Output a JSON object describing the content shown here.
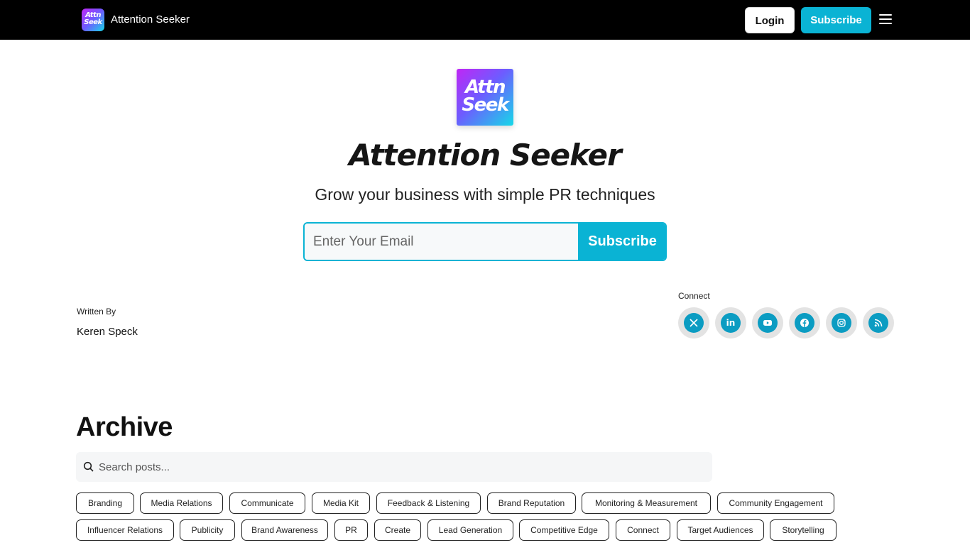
{
  "nav": {
    "logo_line1": "Attn",
    "logo_line2": "Seek",
    "title": "Attention Seeker",
    "login_label": "Login",
    "subscribe_label": "Subscribe"
  },
  "hero": {
    "logo_line1": "Attn",
    "logo_line2": "Seek",
    "title": "Attention Seeker",
    "subtitle": "Grow your business with simple PR techniques",
    "email_placeholder": "Enter Your Email",
    "subscribe_label": "Subscribe"
  },
  "author": {
    "label": "Written By",
    "name": "Keren Speck"
  },
  "connect": {
    "label": "Connect",
    "icons": [
      "x-icon",
      "linkedin-icon",
      "youtube-icon",
      "facebook-icon",
      "instagram-icon",
      "rss-icon"
    ]
  },
  "archive": {
    "title": "Archive",
    "search_placeholder": "Search posts...",
    "tags_row1": [
      "Branding",
      "Media Relations",
      "Communicate",
      "Media Kit",
      "Feedback & Listening",
      "Brand Reputation",
      "Monitoring & Measurement",
      "Community Engagement"
    ],
    "tags_row2": [
      "Influencer Relations",
      "Publicity",
      "Brand Awareness",
      "PR",
      "Create",
      "Lead Generation",
      "Competitive Edge",
      "Connect",
      "Target Audiences",
      "Storytelling"
    ]
  },
  "colors": {
    "accent": "#0ab3d4",
    "navbar": "#000000",
    "social_icon": "#0b9cc2"
  }
}
